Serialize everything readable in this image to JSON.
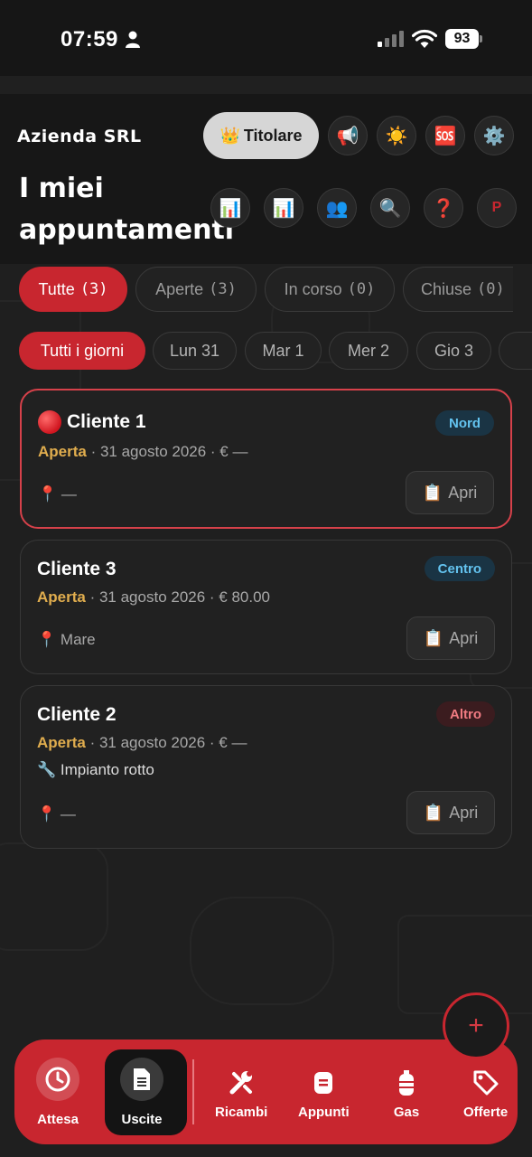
{
  "status_bar": {
    "time": "07:59",
    "battery": "93"
  },
  "header": {
    "company": "Azienda SRL",
    "role_label": "Titolare",
    "role_icon": "👑",
    "title": "I miei appuntamenti",
    "top_buttons": [
      {
        "name": "megaphone-icon",
        "glyph": "📢"
      },
      {
        "name": "sun-icon",
        "glyph": "☀️"
      },
      {
        "name": "sos-icon",
        "glyph": "🆘"
      },
      {
        "name": "gear-icon",
        "glyph": "⚙️"
      }
    ],
    "second_buttons": [
      {
        "name": "bar-chart-icon",
        "glyph": "📊"
      },
      {
        "name": "bar-chart-icon",
        "glyph": "📊"
      },
      {
        "name": "users-icon",
        "glyph": "👥"
      },
      {
        "name": "search-icon",
        "glyph": "🔍"
      },
      {
        "name": "question-icon",
        "glyph": "❓"
      },
      {
        "name": "profile-icon",
        "glyph": "P"
      }
    ]
  },
  "filters": [
    {
      "label": "Tutte",
      "count": "(3)",
      "active": true
    },
    {
      "label": "Aperte",
      "count": "(3)",
      "active": false
    },
    {
      "label": "In corso",
      "count": "(0)",
      "active": false
    },
    {
      "label": "Chiuse",
      "count": "(0)",
      "active": false
    }
  ],
  "days": [
    {
      "label": "Tutti i giorni",
      "active": true
    },
    {
      "label": "Lun 31",
      "active": false
    },
    {
      "label": "Mar 1",
      "active": false
    },
    {
      "label": "Mer 2",
      "active": false
    },
    {
      "label": "Gio 3",
      "active": false
    }
  ],
  "appointments": [
    {
      "client": "Cliente 1",
      "urgent": true,
      "zone": "Nord",
      "status": "Aperta",
      "date": "31 agosto 2026",
      "price": "€ —",
      "location": "—",
      "open_label": "Apri"
    },
    {
      "client": "Cliente 3",
      "urgent": false,
      "zone": "Centro",
      "status": "Aperta",
      "date": "31 agosto 2026",
      "price": "€ 80.00",
      "location": "Mare",
      "open_label": "Apri"
    },
    {
      "client": "Cliente 2",
      "urgent": false,
      "zone": "Altro",
      "status": "Aperta",
      "date": "31 agosto 2026",
      "price": "€ —",
      "note": "Impianto rotto",
      "location": "—",
      "open_label": "Apri"
    }
  ],
  "fab_label": "+",
  "nav": [
    {
      "label": "Attesa",
      "icon": "clock-icon"
    },
    {
      "label": "Uscite",
      "icon": "document-icon",
      "active": true
    },
    {
      "label": "Ricambi",
      "icon": "tools-icon"
    },
    {
      "label": "Appunti",
      "icon": "notes-icon"
    },
    {
      "label": "Gas",
      "icon": "gas-cylinder-icon"
    },
    {
      "label": "Offerte",
      "icon": "tag-icon"
    }
  ],
  "colors": {
    "accent": "#c8262f",
    "status_open": "#e0ad4e",
    "zone_blue": "#63c3ef",
    "zone_red": "#f07b82"
  }
}
